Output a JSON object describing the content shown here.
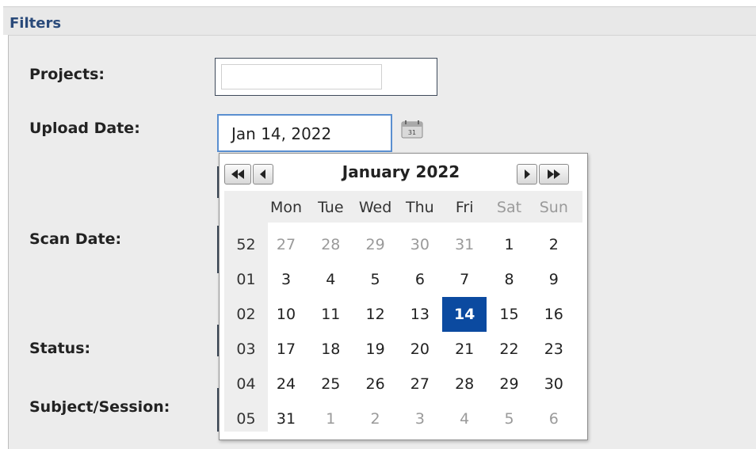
{
  "panel": {
    "title": "Filters"
  },
  "labels": {
    "projects": "Projects:",
    "upload_date": "Upload Date:",
    "scan_date": "Scan Date:",
    "status": "Status:",
    "subject_session": "Subject/Session:"
  },
  "upload_date": {
    "value": "Jan 14, 2022",
    "icon": "calendar-icon"
  },
  "calendar": {
    "title": "January 2022",
    "nav": {
      "prev_year_icon": "double-left-arrow-icon",
      "prev_month_icon": "left-arrow-icon",
      "next_month_icon": "right-arrow-icon",
      "next_year_icon": "double-right-arrow-icon"
    },
    "weekdays": [
      "Mon",
      "Tue",
      "Wed",
      "Thu",
      "Fri",
      "Sat",
      "Sun"
    ],
    "weekend_columns": [
      5,
      6
    ],
    "weeks": [
      {
        "week": "52",
        "days": [
          "27",
          "28",
          "29",
          "30",
          "31",
          "1",
          "2"
        ],
        "other_month": [
          true,
          true,
          true,
          true,
          true,
          false,
          false
        ]
      },
      {
        "week": "01",
        "days": [
          "3",
          "4",
          "5",
          "6",
          "7",
          "8",
          "9"
        ],
        "other_month": [
          false,
          false,
          false,
          false,
          false,
          false,
          false
        ]
      },
      {
        "week": "02",
        "days": [
          "10",
          "11",
          "12",
          "13",
          "14",
          "15",
          "16"
        ],
        "other_month": [
          false,
          false,
          false,
          false,
          false,
          false,
          false
        ]
      },
      {
        "week": "03",
        "days": [
          "17",
          "18",
          "19",
          "20",
          "21",
          "22",
          "23"
        ],
        "other_month": [
          false,
          false,
          false,
          false,
          false,
          false,
          false
        ]
      },
      {
        "week": "04",
        "days": [
          "24",
          "25",
          "26",
          "27",
          "28",
          "29",
          "30"
        ],
        "other_month": [
          false,
          false,
          false,
          false,
          false,
          false,
          false
        ]
      },
      {
        "week": "05",
        "days": [
          "31",
          "1",
          "2",
          "3",
          "4",
          "5",
          "6"
        ],
        "other_month": [
          false,
          true,
          true,
          true,
          true,
          true,
          true
        ]
      }
    ],
    "selected_day": "14",
    "colors": {
      "selected_bg": "#0b4aa0",
      "header_bg": "#eeeeee",
      "muted_text": "#9a9a9a",
      "title_blue": "#2a4a7a"
    }
  }
}
